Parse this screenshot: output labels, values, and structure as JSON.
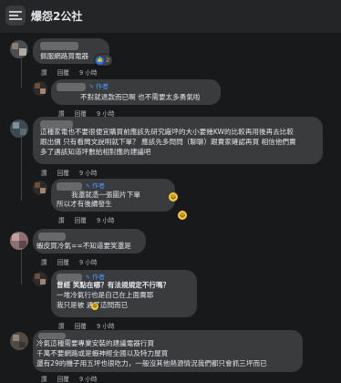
{
  "group": {
    "title": "爆怨2公社"
  },
  "comments": [
    {
      "id": "c1",
      "lines": [
        "佩服網路買電器"
      ],
      "actions": [
        "讚",
        "回覆",
        "9 小時"
      ],
      "reaction_count": "2"
    },
    {
      "id": "c2",
      "author_tag": "作者",
      "lines": [
        "不對就退款而已啊 也不需要太多勇氣啦"
      ],
      "actions": [
        "讚",
        "回覆",
        "9 小時"
      ]
    },
    {
      "id": "c3",
      "lines": [
        "這種家電也不要很便宜購買前應該先研究廠坪的大小要幾KW的比較再用後再去比較",
        "跟出價 只有看闆文說明就下單？ 應該先多問問（聊聊）跟賣家確認再買 相信他們賣",
        "多了遇該知道坪數給相對應的建議吧"
      ],
      "actions": [
        "讚",
        "回覆",
        "9 小時"
      ]
    },
    {
      "id": "c4",
      "author_tag": "作者",
      "lines": [
        "我還就憑一張圖片下單",
        "所以才有後續發生"
      ],
      "actions": [
        "讚",
        "回覆",
        "9 小時"
      ]
    },
    {
      "id": "c5",
      "lines": [
        "蝦皮買冷氣==不知道要笑還是"
      ],
      "actions": [
        "讚",
        "回覆",
        "9 小時"
      ]
    },
    {
      "id": "c6",
      "author_tag": "作者",
      "lines": [
        "曾經 笑點在哪？有法規規定不行嗎？",
        "一堆冷氣行也是自己在上面賣耶",
        "我只是被",
        "遇了這問而已"
      ],
      "actions": [
        "讚",
        "回覆",
        "9 小時"
      ]
    },
    {
      "id": "c7",
      "lines": [
        "冷氣這種需要專業安裝的建議電器行買",
        "千萬不要網路或是蝦神經全國以及特力屋買",
        "還有29的機子用五坪也很吃力，一般沒其他熱源情況我們都只會抓三坪而已"
      ],
      "actions": [
        "讚",
        "回覆",
        "9 小時"
      ]
    }
  ]
}
